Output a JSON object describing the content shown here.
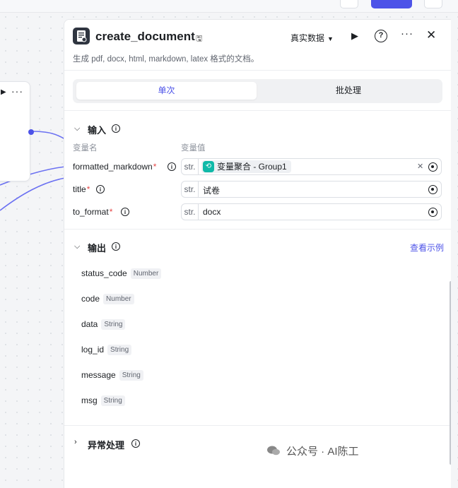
{
  "node": {
    "title": "create_document",
    "description": "生成 pdf, docx, html, markdown, latex 格式的文档。",
    "mode_label": "真实数据"
  },
  "tabs": [
    {
      "label": "单次",
      "active": true
    },
    {
      "label": "批处理",
      "active": false
    }
  ],
  "input": {
    "section_title": "输入",
    "col_name": "变量名",
    "col_value": "变量值",
    "rows": [
      {
        "name": "formatted_markdown",
        "type": "str.",
        "ref": "变量聚合 - Group1",
        "value": ""
      },
      {
        "name": "title",
        "type": "str.",
        "value": "试卷"
      },
      {
        "name": "to_format",
        "type": "str.",
        "value": "docx"
      }
    ]
  },
  "output": {
    "section_title": "输出",
    "view_example": "查看示例",
    "fields": [
      {
        "name": "status_code",
        "type": "Number"
      },
      {
        "name": "code",
        "type": "Number"
      },
      {
        "name": "data",
        "type": "String"
      },
      {
        "name": "log_id",
        "type": "String"
      },
      {
        "name": "message",
        "type": "String"
      },
      {
        "name": "msg",
        "type": "String"
      }
    ]
  },
  "exception": {
    "section_title": "异常处理"
  },
  "watermark": "公众号 · AI陈工",
  "colors": {
    "accent": "#4d53e8",
    "required": "#e54545",
    "ref_icon": "#0fb9a8"
  }
}
